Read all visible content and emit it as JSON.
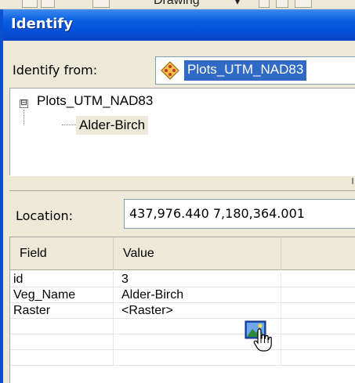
{
  "toolbar": {
    "drawing_label": "Drawing",
    "dropdown_glyph": "▾"
  },
  "window": {
    "title": "Identify"
  },
  "identify_from": {
    "label": "Identify from:",
    "selected_layer": "Plots_UTM_NAD83",
    "layer_icon": "feature-layer-icon"
  },
  "tree": {
    "expander": "⊟",
    "root": "Plots_UTM_NAD83",
    "child": "Alder-Birch"
  },
  "location": {
    "label": "Location:",
    "value": "437,976.440  7,180,364.001"
  },
  "attributes": {
    "columns": [
      "Field",
      "Value"
    ],
    "rows": [
      {
        "field": "id",
        "value": "3"
      },
      {
        "field": "Veg_Name",
        "value": "Alder-Birch"
      },
      {
        "field": "Raster",
        "value": "<Raster>"
      },
      {
        "field": "",
        "value": ""
      },
      {
        "field": "",
        "value": ""
      },
      {
        "field": "",
        "value": ""
      }
    ]
  },
  "icons": {
    "raster": "raster-image-icon",
    "cursor": "hand-cursor-icon"
  },
  "colors": {
    "title_bar": "#0a5fe0",
    "selection": "#316ac5",
    "window_bg": "#ece9d8"
  }
}
